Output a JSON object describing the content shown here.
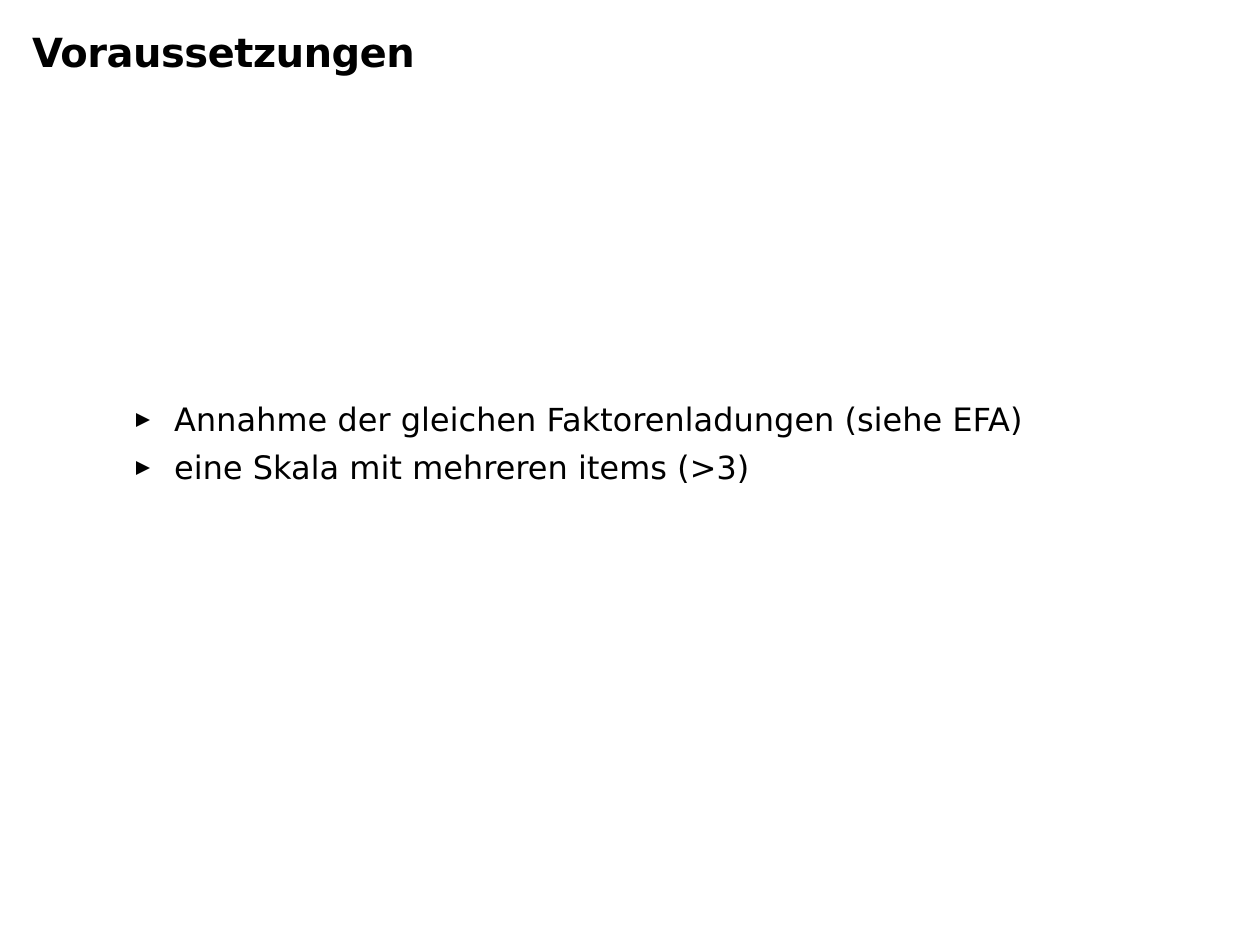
{
  "slide": {
    "title": "Voraussetzungen",
    "bullets": [
      "Annahme der gleichen Faktorenladungen (siehe EFA)",
      "eine Skala mit mehreren items (>3)"
    ],
    "bullet_marker_icon": "triangle-right-icon"
  }
}
